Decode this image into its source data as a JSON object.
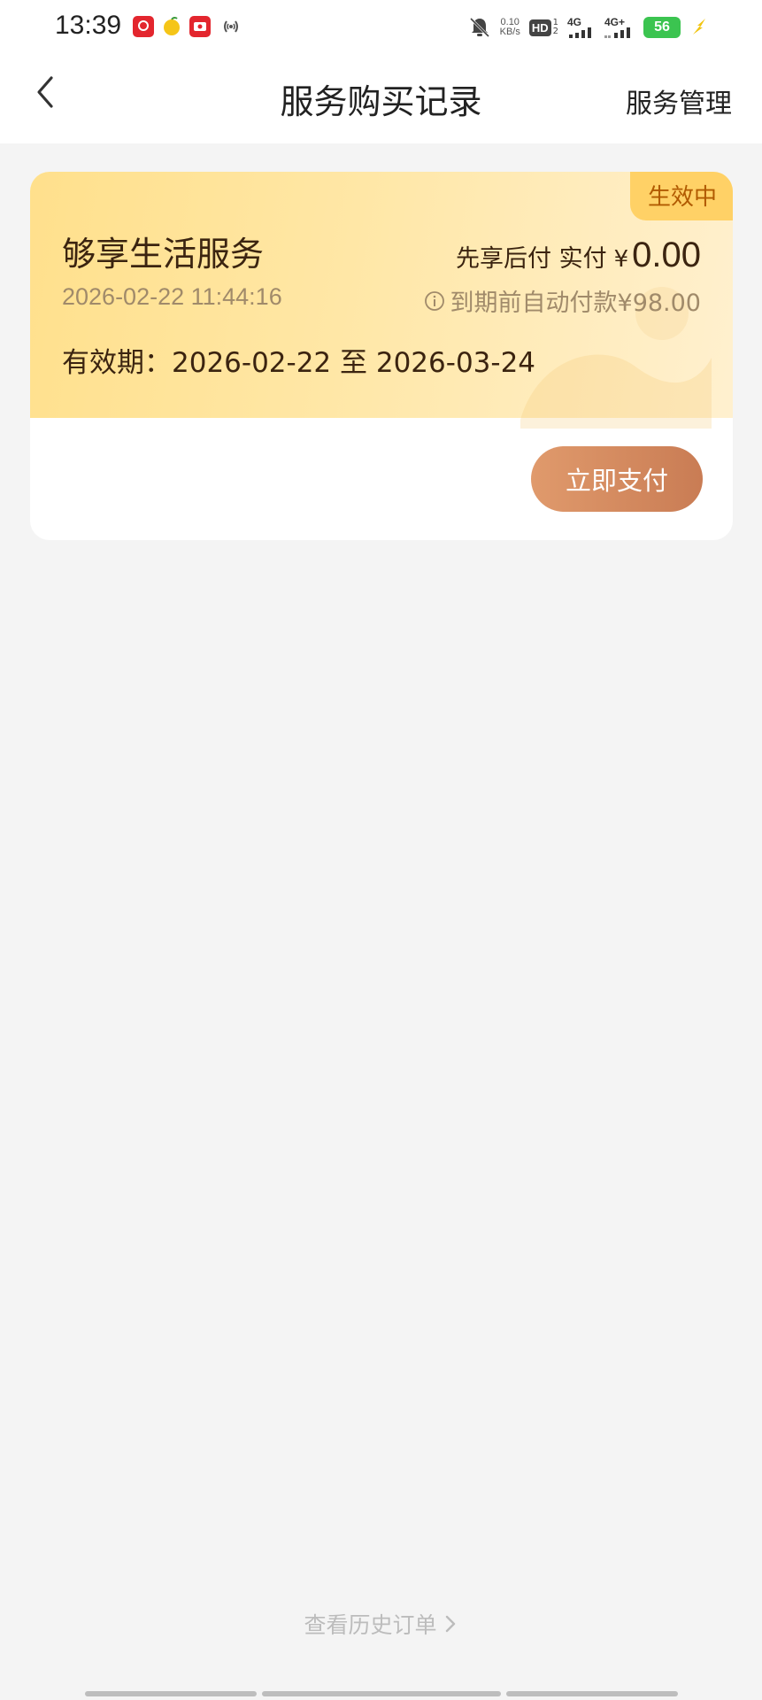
{
  "status_bar": {
    "time": "13:39",
    "net_speed_value": "0.10",
    "net_speed_unit": "KB/s",
    "hd_label": "HD",
    "hd_sup_top": "1",
    "hd_sup_bottom": "2",
    "signal1_label": "4G",
    "signal2_label": "4G+",
    "battery": "56",
    "icons": [
      "pinduoduo-app-icon",
      "fruit-app-icon",
      "video-app-icon",
      "hotspot-icon",
      "mute-bell-icon",
      "charging-icon"
    ],
    "battery_color": "#3bc450"
  },
  "nav": {
    "title": "服务购买记录",
    "action": "服务管理"
  },
  "card": {
    "status_tag": "生效中",
    "service_name": "够享生活服务",
    "purchase_time": "2026-02-22 11:44:16",
    "price_label": "先享后付 实付",
    "currency": "¥",
    "price_value": "0.00",
    "auto_pay_note": "到期前自动付款¥98.00",
    "validity": "有效期：2026-02-22 至 2026-03-24",
    "pay_button": "立即支付",
    "colors": {
      "gradient_start": "#ffe08c",
      "gradient_end": "#fff0cf",
      "tag_bg": "#ffd166",
      "tag_text": "#b15a00",
      "button_start": "#e09a6c",
      "button_end": "#c97c54"
    }
  },
  "footer": {
    "history_link": "查看历史订单"
  }
}
